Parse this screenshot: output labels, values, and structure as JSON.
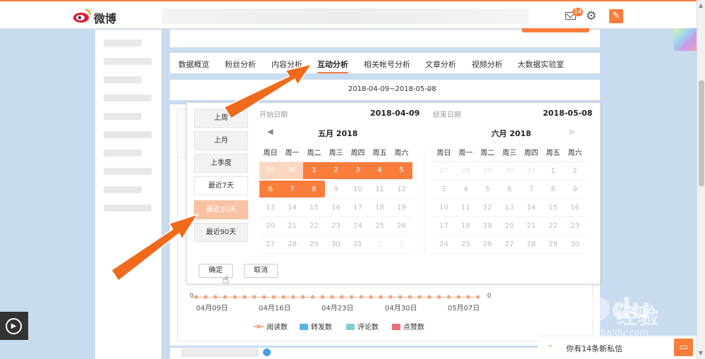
{
  "header": {
    "logo_text": "微博",
    "mail_badge": "14",
    "mail_icon": "mail-icon",
    "settings_icon": "gear-icon",
    "compose_icon": "compose-icon",
    "accent": "#fa7d3c"
  },
  "nav": {
    "tabs": [
      {
        "label": "数据概览",
        "active": false
      },
      {
        "label": "粉丝分析",
        "active": false
      },
      {
        "label": "内容分析",
        "active": false
      },
      {
        "label": "互动分析",
        "active": true
      },
      {
        "label": "相关帐号分析",
        "active": false
      },
      {
        "label": "文章分析",
        "active": false
      },
      {
        "label": "视频分析",
        "active": false
      },
      {
        "label": "大数据实验室",
        "active": false
      }
    ]
  },
  "date_selector": {
    "range": "2018-04-09~2018-05-08"
  },
  "picker": {
    "presets": [
      {
        "label": "上周",
        "selected": false
      },
      {
        "label": "上月",
        "selected": false
      },
      {
        "label": "上季度",
        "selected": false
      },
      {
        "label": "最近7天",
        "selected": false
      },
      {
        "label": "最近30天",
        "selected": true
      },
      {
        "label": "最近90天",
        "selected": false
      }
    ],
    "start_label": "开始日期",
    "start_value": "2018-04-09",
    "end_label": "结束日期",
    "end_value": "2018-05-08",
    "weekdays": [
      "周日",
      "周一",
      "周二",
      "周三",
      "周四",
      "周五",
      "周六"
    ],
    "left_month": {
      "title": "五月 2018",
      "rows": [
        [
          "29",
          "30",
          "1",
          "2",
          "3",
          "4",
          "5"
        ],
        [
          "6",
          "7",
          "8",
          "9",
          "10",
          "11",
          "12"
        ],
        [
          "13",
          "14",
          "15",
          "16",
          "17",
          "18",
          "19"
        ],
        [
          "20",
          "21",
          "22",
          "23",
          "24",
          "25",
          "26"
        ],
        [
          "27",
          "28",
          "29",
          "30",
          "31",
          "1",
          "2"
        ]
      ]
    },
    "right_month": {
      "title": "六月 2018",
      "rows": [
        [
          "27",
          "28",
          "29",
          "30",
          "31",
          "1",
          "2"
        ],
        [
          "3",
          "4",
          "5",
          "6",
          "7",
          "8",
          "9"
        ],
        [
          "10",
          "11",
          "12",
          "13",
          "14",
          "15",
          "16"
        ],
        [
          "17",
          "18",
          "19",
          "20",
          "21",
          "22",
          "23"
        ],
        [
          "24",
          "25",
          "26",
          "27",
          "28",
          "29",
          "30"
        ]
      ]
    },
    "confirm_label": "确定",
    "cancel_label": "取消"
  },
  "chart": {
    "y_left": "0",
    "y_right": "0",
    "x_labels": [
      "04月09日",
      "04月16日",
      "04月23日",
      "04月30日",
      "05月07日"
    ],
    "legend": [
      {
        "name": "阅读数",
        "color": "#f5b08a",
        "kind": "line"
      },
      {
        "name": "转发数",
        "color": "#5ab1e6",
        "kind": "box"
      },
      {
        "name": "评论数",
        "color": "#82d0cc",
        "kind": "box"
      },
      {
        "name": "点赞数",
        "color": "#ec6f7a",
        "kind": "box"
      }
    ]
  },
  "messages": {
    "text": "你有14条新私信"
  },
  "watermark": {
    "brand": "Bai",
    "brand2": "du",
    "cn": "经验",
    "url": "jingyan.baidu.com"
  }
}
